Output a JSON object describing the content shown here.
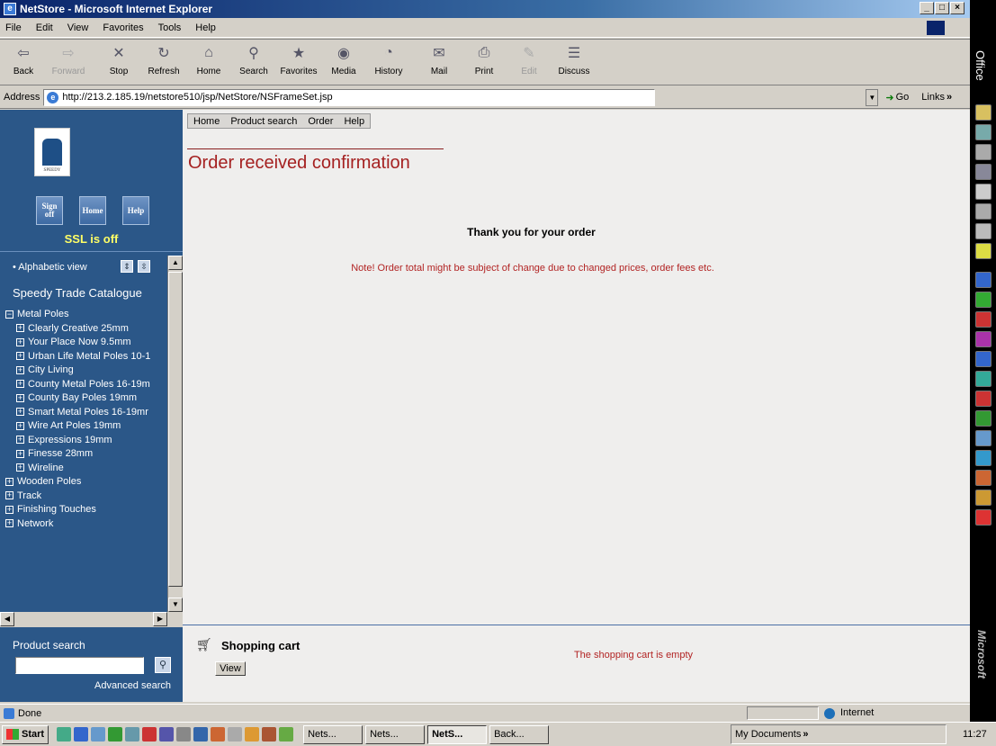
{
  "window": {
    "title": "NetStore - Microsoft Internet Explorer"
  },
  "menu": [
    "File",
    "Edit",
    "View",
    "Favorites",
    "Tools",
    "Help"
  ],
  "toolbar": [
    {
      "label": "Back",
      "icon": "back-arrow-icon",
      "glyph": "⇦",
      "disabled": false
    },
    {
      "label": "Forward",
      "icon": "forward-arrow-icon",
      "glyph": "⇨",
      "disabled": true
    },
    {
      "label": "Stop",
      "icon": "stop-icon",
      "glyph": "✕",
      "disabled": false
    },
    {
      "label": "Refresh",
      "icon": "refresh-icon",
      "glyph": "↻",
      "disabled": false
    },
    {
      "label": "Home",
      "icon": "home-icon",
      "glyph": "⌂",
      "disabled": false
    },
    {
      "label": "Search",
      "icon": "search-icon",
      "glyph": "⚲",
      "disabled": false
    },
    {
      "label": "Favorites",
      "icon": "favorites-icon",
      "glyph": "★",
      "disabled": false
    },
    {
      "label": "Media",
      "icon": "media-icon",
      "glyph": "◉",
      "disabled": false
    },
    {
      "label": "History",
      "icon": "history-icon",
      "glyph": "◔",
      "disabled": false
    },
    {
      "label": "Mail",
      "icon": "mail-icon",
      "glyph": "✉",
      "disabled": false
    },
    {
      "label": "Print",
      "icon": "print-icon",
      "glyph": "⎙",
      "disabled": false
    },
    {
      "label": "Edit",
      "icon": "edit-icon",
      "glyph": "✎",
      "disabled": true
    },
    {
      "label": "Discuss",
      "icon": "discuss-icon",
      "glyph": "☰",
      "disabled": false
    }
  ],
  "address": {
    "label": "Address",
    "url": "http://213.2.185.19/netstore510/jsp/NetStore/NSFrameSet.jsp",
    "go": "Go",
    "links": "Links"
  },
  "sidebar": {
    "sign_off": "Sign off",
    "home": "Home",
    "help": "Help",
    "ssl": "SSL is off",
    "alphabetic_view": "• Alphabetic view",
    "catalogue_title": "Speedy Trade Catalogue",
    "tree": [
      {
        "label": "Metal Poles",
        "level": 0,
        "expanded": true
      },
      {
        "label": "Clearly Creative 25mm",
        "level": 1
      },
      {
        "label": "Your Place Now 9.5mm",
        "level": 1
      },
      {
        "label": "Urban Life Metal Poles 10-1",
        "level": 1
      },
      {
        "label": "City Living",
        "level": 1
      },
      {
        "label": "County Metal Poles 16-19m",
        "level": 1
      },
      {
        "label": "County Bay Poles 19mm",
        "level": 1
      },
      {
        "label": "Smart Metal Poles 16-19mr",
        "level": 1
      },
      {
        "label": "Wire Art Poles 19mm",
        "level": 1
      },
      {
        "label": "Expressions 19mm",
        "level": 1
      },
      {
        "label": "Finesse 28mm",
        "level": 1
      },
      {
        "label": "Wireline",
        "level": 1
      },
      {
        "label": "Wooden Poles",
        "level": 0
      },
      {
        "label": "Track",
        "level": 0
      },
      {
        "label": "Finishing Touches",
        "level": 0
      },
      {
        "label": "Network",
        "level": 0
      }
    ],
    "product_search_label": "Product search",
    "advanced_search": "Advanced search"
  },
  "nav": [
    "Home",
    "Product search",
    "Order",
    "Help"
  ],
  "main": {
    "title": "Order received confirmation",
    "thanks": "Thank you for your order",
    "note": "Note! Order total might be subject of change due to changed prices, order fees etc."
  },
  "cart": {
    "title": "Shopping cart",
    "view_button": "View",
    "empty_text": "The shopping cart is empty"
  },
  "status": {
    "text": "Done",
    "zone": "Internet"
  },
  "taskbar": {
    "start": "Start",
    "tasks": [
      {
        "label": "Nets...",
        "active": false
      },
      {
        "label": "Nets...",
        "active": false
      },
      {
        "label": "NetS...",
        "active": true
      },
      {
        "label": "Back...",
        "active": false
      }
    ],
    "my_documents": "My Documents",
    "clock": "11:27"
  },
  "office": {
    "label": "Office",
    "brand": "Microsoft"
  }
}
